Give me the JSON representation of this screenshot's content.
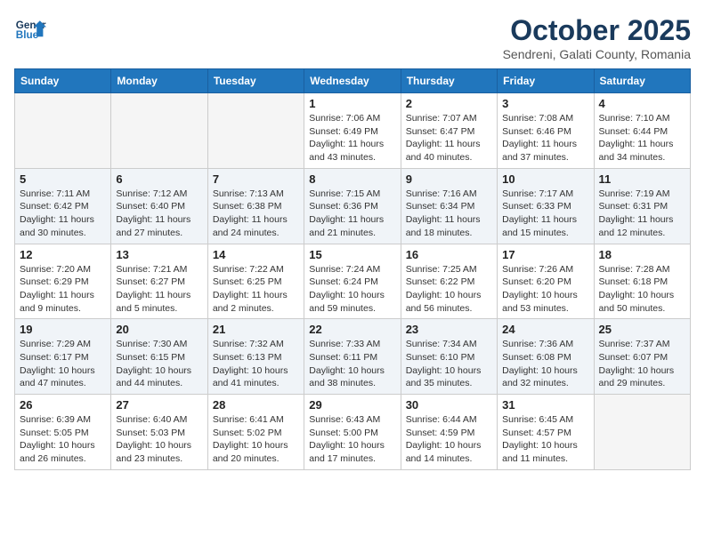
{
  "header": {
    "logo_line1": "General",
    "logo_line2": "Blue",
    "title": "October 2025",
    "subtitle": "Sendreni, Galati County, Romania"
  },
  "weekdays": [
    "Sunday",
    "Monday",
    "Tuesday",
    "Wednesday",
    "Thursday",
    "Friday",
    "Saturday"
  ],
  "weeks": [
    [
      {
        "day": "",
        "info": ""
      },
      {
        "day": "",
        "info": ""
      },
      {
        "day": "",
        "info": ""
      },
      {
        "day": "1",
        "info": "Sunrise: 7:06 AM\nSunset: 6:49 PM\nDaylight: 11 hours\nand 43 minutes."
      },
      {
        "day": "2",
        "info": "Sunrise: 7:07 AM\nSunset: 6:47 PM\nDaylight: 11 hours\nand 40 minutes."
      },
      {
        "day": "3",
        "info": "Sunrise: 7:08 AM\nSunset: 6:46 PM\nDaylight: 11 hours\nand 37 minutes."
      },
      {
        "day": "4",
        "info": "Sunrise: 7:10 AM\nSunset: 6:44 PM\nDaylight: 11 hours\nand 34 minutes."
      }
    ],
    [
      {
        "day": "5",
        "info": "Sunrise: 7:11 AM\nSunset: 6:42 PM\nDaylight: 11 hours\nand 30 minutes."
      },
      {
        "day": "6",
        "info": "Sunrise: 7:12 AM\nSunset: 6:40 PM\nDaylight: 11 hours\nand 27 minutes."
      },
      {
        "day": "7",
        "info": "Sunrise: 7:13 AM\nSunset: 6:38 PM\nDaylight: 11 hours\nand 24 minutes."
      },
      {
        "day": "8",
        "info": "Sunrise: 7:15 AM\nSunset: 6:36 PM\nDaylight: 11 hours\nand 21 minutes."
      },
      {
        "day": "9",
        "info": "Sunrise: 7:16 AM\nSunset: 6:34 PM\nDaylight: 11 hours\nand 18 minutes."
      },
      {
        "day": "10",
        "info": "Sunrise: 7:17 AM\nSunset: 6:33 PM\nDaylight: 11 hours\nand 15 minutes."
      },
      {
        "day": "11",
        "info": "Sunrise: 7:19 AM\nSunset: 6:31 PM\nDaylight: 11 hours\nand 12 minutes."
      }
    ],
    [
      {
        "day": "12",
        "info": "Sunrise: 7:20 AM\nSunset: 6:29 PM\nDaylight: 11 hours\nand 9 minutes."
      },
      {
        "day": "13",
        "info": "Sunrise: 7:21 AM\nSunset: 6:27 PM\nDaylight: 11 hours\nand 5 minutes."
      },
      {
        "day": "14",
        "info": "Sunrise: 7:22 AM\nSunset: 6:25 PM\nDaylight: 11 hours\nand 2 minutes."
      },
      {
        "day": "15",
        "info": "Sunrise: 7:24 AM\nSunset: 6:24 PM\nDaylight: 10 hours\nand 59 minutes."
      },
      {
        "day": "16",
        "info": "Sunrise: 7:25 AM\nSunset: 6:22 PM\nDaylight: 10 hours\nand 56 minutes."
      },
      {
        "day": "17",
        "info": "Sunrise: 7:26 AM\nSunset: 6:20 PM\nDaylight: 10 hours\nand 53 minutes."
      },
      {
        "day": "18",
        "info": "Sunrise: 7:28 AM\nSunset: 6:18 PM\nDaylight: 10 hours\nand 50 minutes."
      }
    ],
    [
      {
        "day": "19",
        "info": "Sunrise: 7:29 AM\nSunset: 6:17 PM\nDaylight: 10 hours\nand 47 minutes."
      },
      {
        "day": "20",
        "info": "Sunrise: 7:30 AM\nSunset: 6:15 PM\nDaylight: 10 hours\nand 44 minutes."
      },
      {
        "day": "21",
        "info": "Sunrise: 7:32 AM\nSunset: 6:13 PM\nDaylight: 10 hours\nand 41 minutes."
      },
      {
        "day": "22",
        "info": "Sunrise: 7:33 AM\nSunset: 6:11 PM\nDaylight: 10 hours\nand 38 minutes."
      },
      {
        "day": "23",
        "info": "Sunrise: 7:34 AM\nSunset: 6:10 PM\nDaylight: 10 hours\nand 35 minutes."
      },
      {
        "day": "24",
        "info": "Sunrise: 7:36 AM\nSunset: 6:08 PM\nDaylight: 10 hours\nand 32 minutes."
      },
      {
        "day": "25",
        "info": "Sunrise: 7:37 AM\nSunset: 6:07 PM\nDaylight: 10 hours\nand 29 minutes."
      }
    ],
    [
      {
        "day": "26",
        "info": "Sunrise: 6:39 AM\nSunset: 5:05 PM\nDaylight: 10 hours\nand 26 minutes."
      },
      {
        "day": "27",
        "info": "Sunrise: 6:40 AM\nSunset: 5:03 PM\nDaylight: 10 hours\nand 23 minutes."
      },
      {
        "day": "28",
        "info": "Sunrise: 6:41 AM\nSunset: 5:02 PM\nDaylight: 10 hours\nand 20 minutes."
      },
      {
        "day": "29",
        "info": "Sunrise: 6:43 AM\nSunset: 5:00 PM\nDaylight: 10 hours\nand 17 minutes."
      },
      {
        "day": "30",
        "info": "Sunrise: 6:44 AM\nSunset: 4:59 PM\nDaylight: 10 hours\nand 14 minutes."
      },
      {
        "day": "31",
        "info": "Sunrise: 6:45 AM\nSunset: 4:57 PM\nDaylight: 10 hours\nand 11 minutes."
      },
      {
        "day": "",
        "info": ""
      }
    ]
  ]
}
